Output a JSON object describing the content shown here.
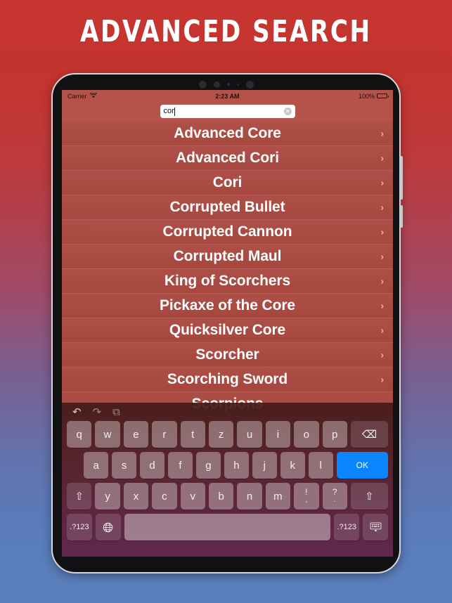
{
  "promo": {
    "title": "ADVANCED SEARCH"
  },
  "status_bar": {
    "carrier": "Carrier",
    "wifi_icon": "wifi-icon",
    "time": "2:23 AM",
    "battery_percent": "100%",
    "battery_icon": "battery-full-icon"
  },
  "search": {
    "value": "cor",
    "clear_icon": "clear-circle-icon"
  },
  "results": {
    "chevron_icon": "chevron-right-icon",
    "items": [
      {
        "label": "Advanced Core"
      },
      {
        "label": "Advanced Cori"
      },
      {
        "label": "Cori"
      },
      {
        "label": "Corrupted Bullet"
      },
      {
        "label": "Corrupted Cannon"
      },
      {
        "label": "Corrupted Maul"
      },
      {
        "label": "King of Scorchers"
      },
      {
        "label": "Pickaxe of the Core"
      },
      {
        "label": "Quicksilver Core"
      },
      {
        "label": "Scorcher"
      },
      {
        "label": "Scorching Sword"
      },
      {
        "label": "Scorpions"
      }
    ]
  },
  "keyboard": {
    "toolbar": [
      {
        "name": "undo-icon",
        "glyph": "↶"
      },
      {
        "name": "redo-icon",
        "glyph": "↷"
      },
      {
        "name": "copy-paste-icon",
        "glyph": "⧉"
      }
    ],
    "row1": [
      "q",
      "w",
      "e",
      "r",
      "t",
      "z",
      "u",
      "i",
      "o",
      "p"
    ],
    "backspace_icon": "backspace-icon",
    "backspace_glyph": "⌫",
    "row2": [
      "a",
      "s",
      "d",
      "f",
      "g",
      "h",
      "j",
      "k",
      "l"
    ],
    "return_label": "OK",
    "shift_glyph": "⇧",
    "row3": [
      "y",
      "x",
      "c",
      "v",
      "b",
      "n",
      "m"
    ],
    "punct1_top": "!",
    "punct1_bottom": ",",
    "punct2_top": "?",
    "punct2_bottom": ".",
    "numbers_label": ".?123",
    "globe_glyph": "⊕",
    "space_label": "",
    "dismiss_glyph": "⌨"
  },
  "colors": {
    "screen_red": "#a84a42",
    "status_red": "#b4534a",
    "accent_blue": "#0a84ff",
    "bg_top": "#c6352f",
    "bg_bottom": "#5b80bd"
  }
}
